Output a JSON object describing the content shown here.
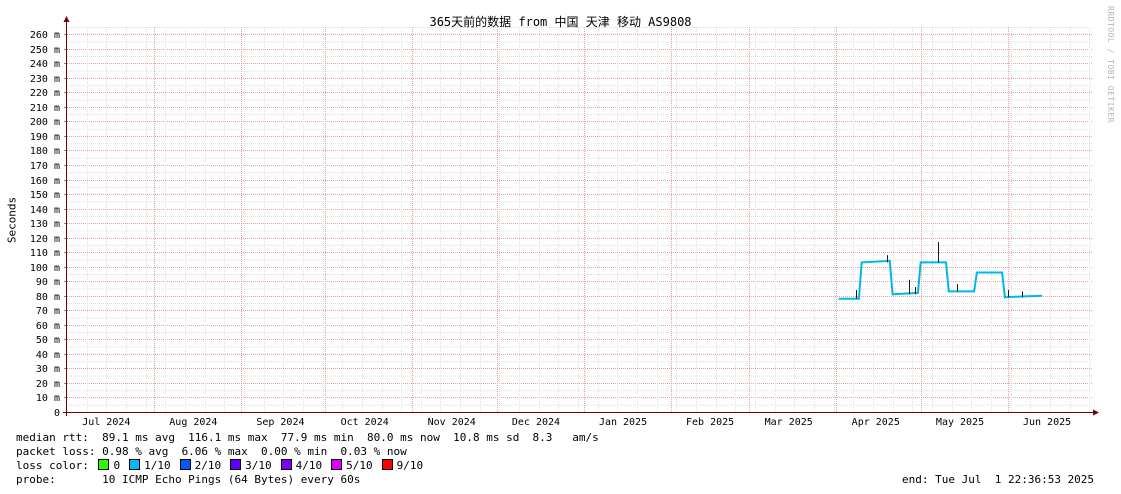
{
  "chart_data": {
    "type": "line",
    "title": "365天前的数据 from 中国 天津 移动 AS9808",
    "ylabel": "Seconds",
    "ylim": [
      0,
      265
    ],
    "y_unit_suffix": "m",
    "yticks": [
      0,
      10,
      20,
      30,
      40,
      50,
      60,
      70,
      80,
      90,
      100,
      110,
      120,
      130,
      140,
      150,
      160,
      170,
      180,
      190,
      200,
      210,
      220,
      230,
      240,
      250,
      260
    ],
    "xlim": [
      "2024-07-01",
      "2025-07-01"
    ],
    "month_labels": [
      {
        "label": "Jul 2024",
        "date": "2024-07-15"
      },
      {
        "label": "Aug 2024",
        "date": "2024-08-15"
      },
      {
        "label": "Sep 2024",
        "date": "2024-09-15"
      },
      {
        "label": "Oct 2024",
        "date": "2024-10-15"
      },
      {
        "label": "Nov 2024",
        "date": "2024-11-15"
      },
      {
        "label": "Dec 2024",
        "date": "2024-12-15"
      },
      {
        "label": "Jan 2025",
        "date": "2025-01-15"
      },
      {
        "label": "Feb 2025",
        "date": "2025-02-15"
      },
      {
        "label": "Mar 2025",
        "date": "2025-03-15"
      },
      {
        "label": "Apr 2025",
        "date": "2025-04-15"
      },
      {
        "label": "May 2025",
        "date": "2025-05-15"
      },
      {
        "label": "Jun 2025",
        "date": "2025-06-15"
      }
    ],
    "grid": true,
    "series": [
      {
        "color": "#00b8e8",
        "points": [
          [
            "2025-04-02",
            78
          ],
          [
            "2025-04-09",
            78
          ],
          [
            "2025-04-10",
            103
          ],
          [
            "2025-04-20",
            104
          ],
          [
            "2025-04-21",
            81
          ],
          [
            "2025-04-30",
            82
          ],
          [
            "2025-05-01",
            103
          ],
          [
            "2025-05-10",
            103
          ],
          [
            "2025-05-11",
            83
          ],
          [
            "2025-05-20",
            83
          ],
          [
            "2025-05-21",
            96
          ],
          [
            "2025-05-30",
            96
          ],
          [
            "2025-05-31",
            79
          ],
          [
            "2025-06-13",
            80
          ]
        ]
      }
    ],
    "spikes": [
      [
        "2025-04-08",
        84
      ],
      [
        "2025-04-19",
        108
      ],
      [
        "2025-04-27",
        91
      ],
      [
        "2025-04-29",
        86
      ],
      [
        "2025-05-07",
        117
      ],
      [
        "2025-05-14",
        88
      ],
      [
        "2025-06-01",
        84
      ],
      [
        "2025-06-06",
        83
      ]
    ]
  },
  "legend": {
    "median_rtt_text": "median rtt:  89.1 ms avg  116.1 ms max  77.9 ms min  80.0 ms now  10.8 ms sd  8.3   am/s",
    "packet_loss_text": "packet loss: 0.98 % avg  6.06 % max  0.00 % min  0.03 % now",
    "loss_color_label": "loss color:",
    "loss_colors": [
      {
        "label": "0",
        "color": "#26ff00"
      },
      {
        "label": "1/10",
        "color": "#00b8ff"
      },
      {
        "label": "2/10",
        "color": "#0059ff"
      },
      {
        "label": "3/10",
        "color": "#5e00ff"
      },
      {
        "label": "4/10",
        "color": "#7e00ff"
      },
      {
        "label": "5/10",
        "color": "#dd00ff"
      },
      {
        "label": "9/10",
        "color": "#ff0000"
      }
    ],
    "probe_text": "probe:       10 ICMP Echo Pings (64 Bytes) every 60s",
    "end_text": "end: Tue Jul  1 22:36:53 2025"
  },
  "watermark": "RRDTOOL / TOBI OETIKER"
}
